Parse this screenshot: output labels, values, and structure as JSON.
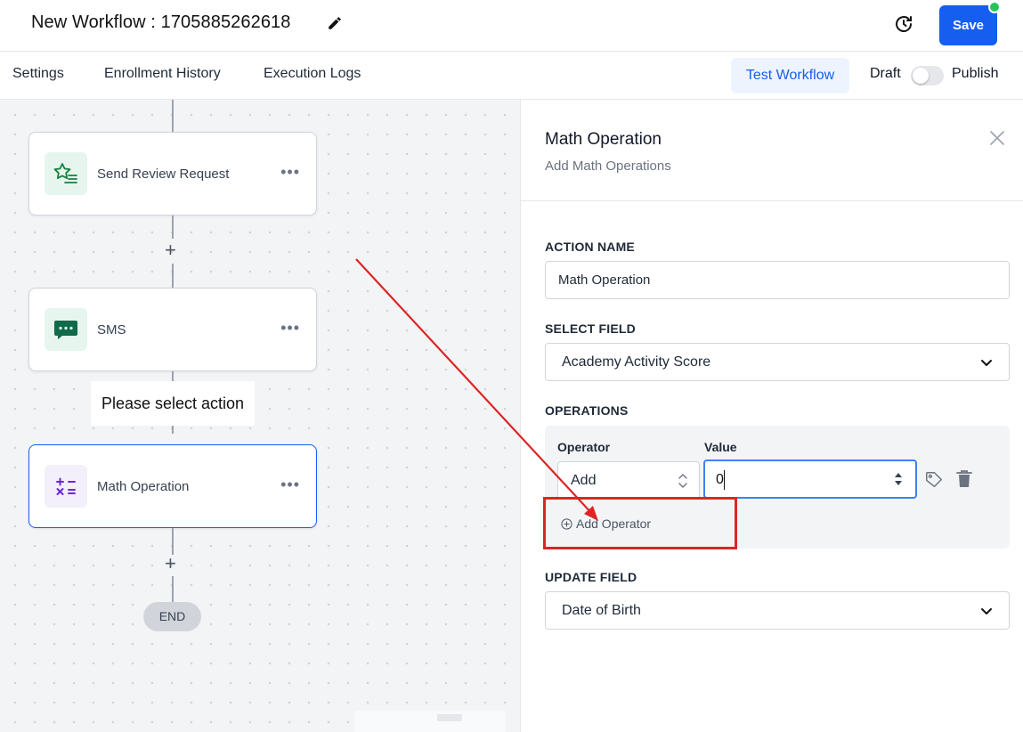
{
  "header": {
    "title": "New Workflow : 1705885262618",
    "save_label": "Save"
  },
  "nav": {
    "items": [
      "Settings",
      "Enrollment History",
      "Execution Logs"
    ],
    "test_workflow_label": "Test Workflow",
    "draft_label": "Draft",
    "publish_label": "Publish"
  },
  "canvas": {
    "nodes": [
      {
        "label": "Send Review Request",
        "icon": "star-list-icon"
      },
      {
        "label": "SMS",
        "icon": "chat-bubble-icon"
      },
      {
        "label": "Math Operation",
        "icon": "math-ops-icon"
      }
    ],
    "tooltip": "Please select action",
    "end_label": "END"
  },
  "panel": {
    "title": "Math Operation",
    "subtitle": "Add Math Operations",
    "action_name_label": "ACTION NAME",
    "action_name_value": "Math Operation",
    "select_field_label": "SELECT FIELD",
    "select_field_value": "Academy Activity Score",
    "operations_label": "OPERATIONS",
    "operator_col": "Operator",
    "value_col": "Value",
    "operator_value": "Add",
    "value_value": "0",
    "add_operator_label": "Add Operator",
    "update_field_label": "UPDATE FIELD",
    "update_field_value": "Date of Birth"
  },
  "colors": {
    "primary": "#155eef",
    "annotation": "#dc2626",
    "status_dot": "#22c55e"
  }
}
